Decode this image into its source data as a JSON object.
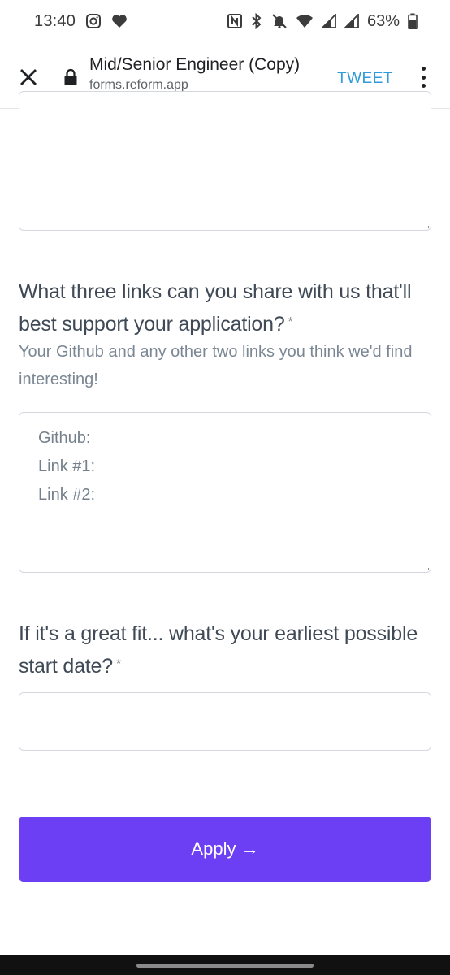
{
  "status_bar": {
    "time": "13:40",
    "battery": "63%",
    "icons_left": [
      "instagram-icon",
      "heart-icon"
    ],
    "icons_right": [
      "nfc-icon",
      "bluetooth-icon",
      "mute-icon",
      "wifi-icon",
      "signal-icon",
      "signal-icon",
      "battery-icon"
    ]
  },
  "header": {
    "title": "Mid/Senior Engineer (Copy)",
    "url": "forms.reform.app",
    "tweet_label": "TWEET"
  },
  "form": {
    "question_links": {
      "label": "What three links can you share with us that'll best support your application?",
      "required_mark": "*",
      "helper": "Your Github and any other two links you think we'd find interesting!",
      "placeholder_lines": [
        "Github:",
        "Link #1:",
        "Link #2:"
      ]
    },
    "question_start_date": {
      "label": "If it's a great fit... what's your earliest possible start date?",
      "required_mark": "*",
      "value": ""
    },
    "apply_label": "Apply →"
  },
  "colors": {
    "accent": "#6c3ff5",
    "tweet": "#2f9bdb",
    "text": "#3f4a56",
    "helper": "#7b8794"
  }
}
